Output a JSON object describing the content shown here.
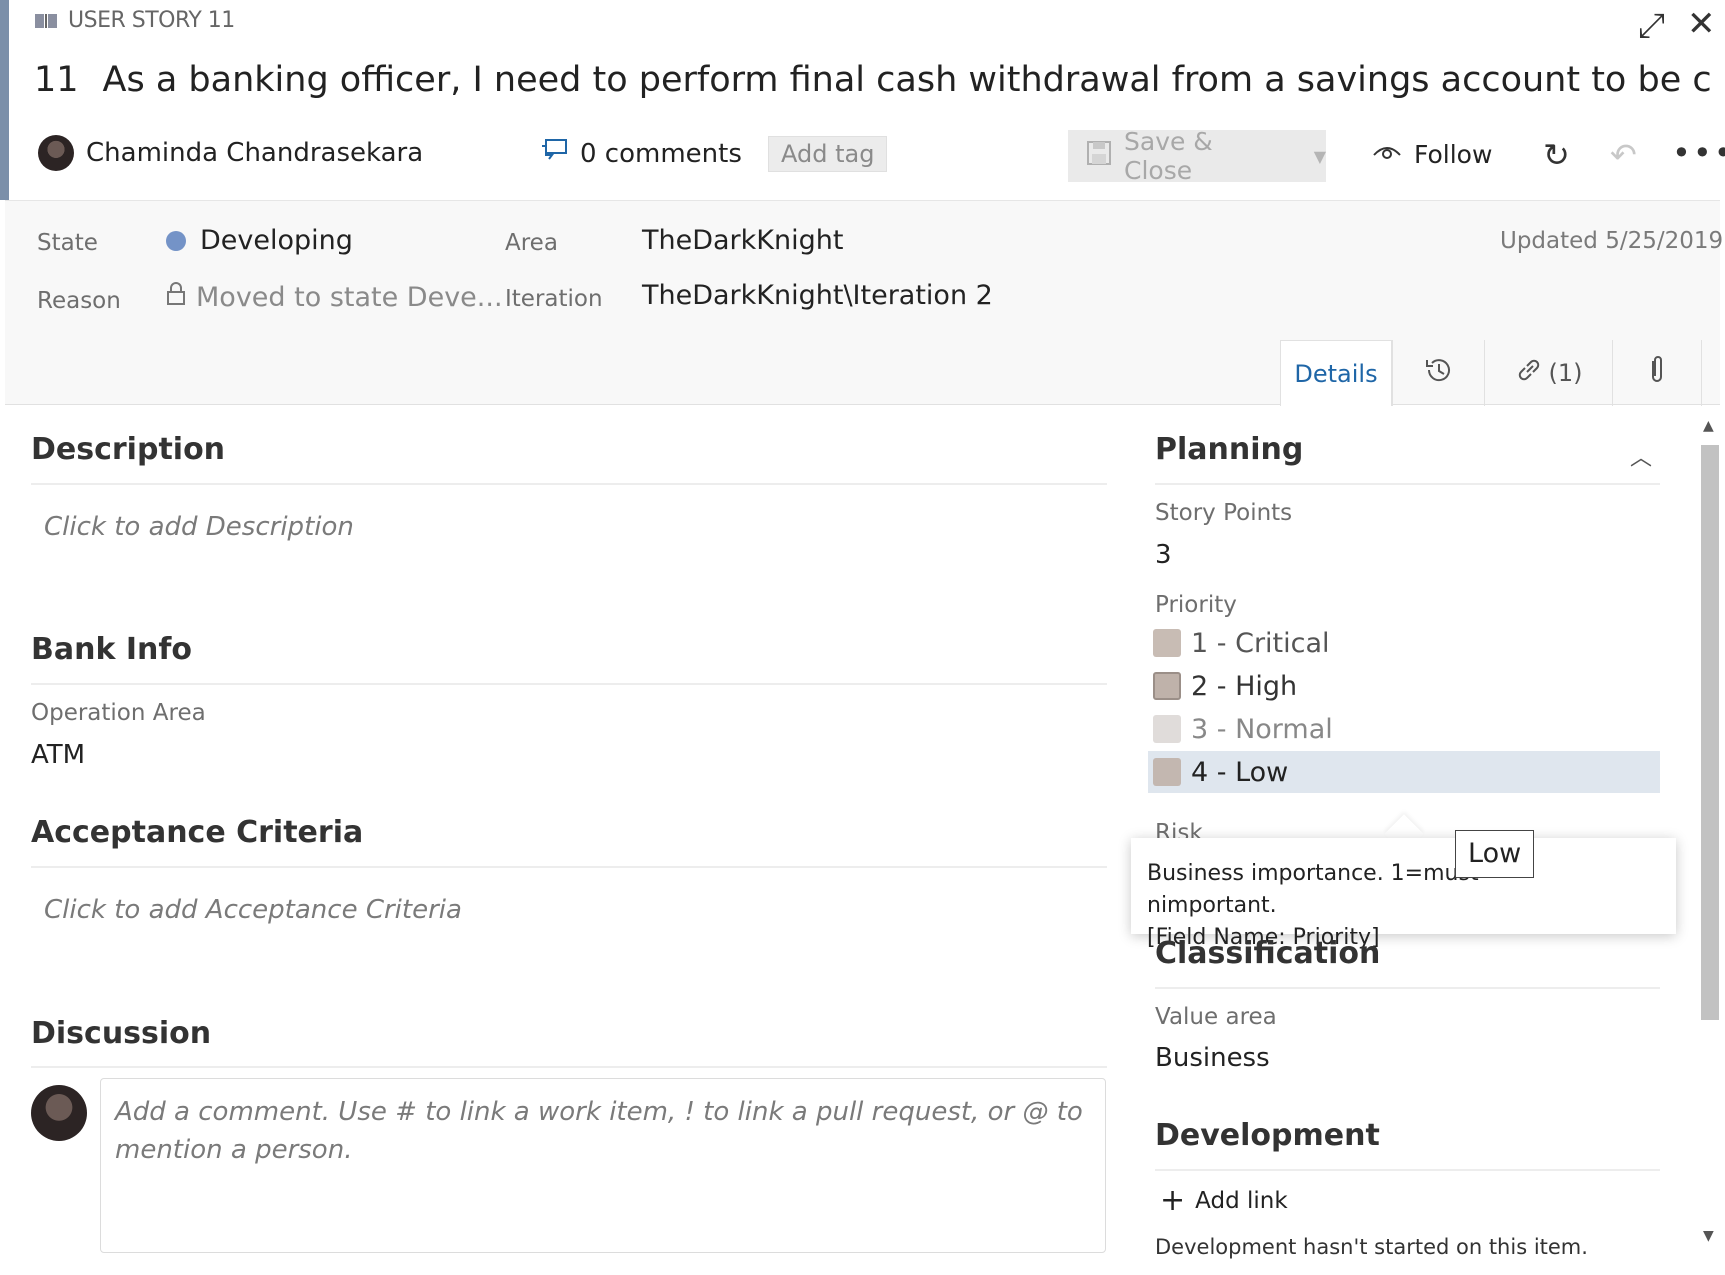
{
  "header": {
    "work_item_type": "USER STORY 11",
    "id": "11",
    "title": "As a banking officer, I need to perform final cash withdrawal from a savings account to be closed acco...",
    "assigned_to": "Chaminda Chandrasekara",
    "comments": "0 comments",
    "add_tag": "Add tag",
    "save_close": "Save & Close",
    "follow": "Follow",
    "accent_color": "#7b8fa9"
  },
  "fields": {
    "state_label": "State",
    "state_value": "Developing",
    "state_color": "#7493c7",
    "reason_label": "Reason",
    "reason_value": "Moved to state Deve...",
    "area_label": "Area",
    "area_value": "TheDarkKnight",
    "iteration_label": "Iteration",
    "iteration_value": "TheDarkKnight\\Iteration 2",
    "updated": "Updated 5/25/2019"
  },
  "tabs": {
    "details": "Details",
    "links": "(1)"
  },
  "left": {
    "description_heading": "Description",
    "description_placeholder": "Click to add Description",
    "bank_info_heading": "Bank Info",
    "operation_area_label": "Operation Area",
    "operation_area_value": "ATM",
    "acceptance_heading": "Acceptance Criteria",
    "acceptance_placeholder": "Click to add Acceptance Criteria",
    "discussion_heading": "Discussion",
    "comment_placeholder": "Add a comment. Use # to link a work item, ! to link a pull request, or @ to mention a person."
  },
  "right": {
    "planning_heading": "Planning",
    "story_points_label": "Story Points",
    "story_points_value": "3",
    "priority_label": "Priority",
    "priority_options": [
      "1 - Critical",
      "2 - High",
      "3 - Normal",
      "4 - Low"
    ],
    "selected_priority": "4 - Low",
    "risk_label": "Risk",
    "tooltip_line1": "Business importance. 1=must",
    "tooltip_line1_end": "nimportant.",
    "tooltip_line2": "[Field Name: Priority]",
    "hover_tip": "Low",
    "classification_heading": "Classification",
    "value_area_label": "Value area",
    "value_area_value": "Business",
    "development_heading": "Development",
    "add_link": "Add link",
    "development_status": "Development hasn't started on this item."
  }
}
